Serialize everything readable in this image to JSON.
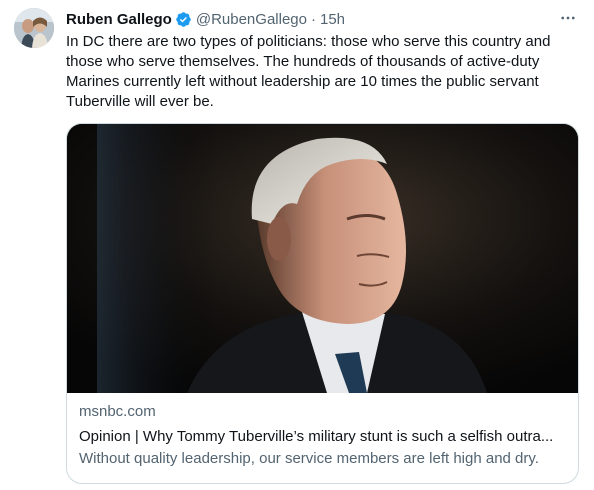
{
  "tweet": {
    "author": {
      "display_name": "Ruben Gallego",
      "handle": "@RubenGallego",
      "verified": true,
      "avatar_icon": "profile-photo"
    },
    "separator": "·",
    "timestamp": "15h",
    "more_icon": "more-horizontal-icon",
    "text": "In DC there are two types of politicians: those who serve this country and those who serve themselves. The hundreds of thousands of active-duty Marines currently left without leadership are 10 times the public servant Tuberville will ever be.",
    "card": {
      "domain": "msnbc.com",
      "title": "Opinion | Why Tommy Tuberville’s military stunt is such a selfish outra...",
      "description": "Without quality leadership, our service members are left high and dry."
    }
  },
  "colors": {
    "text_primary": "#0f1419",
    "text_secondary": "#536471",
    "verified_badge": "#1d9bf0",
    "card_border": "#cfd9de"
  }
}
